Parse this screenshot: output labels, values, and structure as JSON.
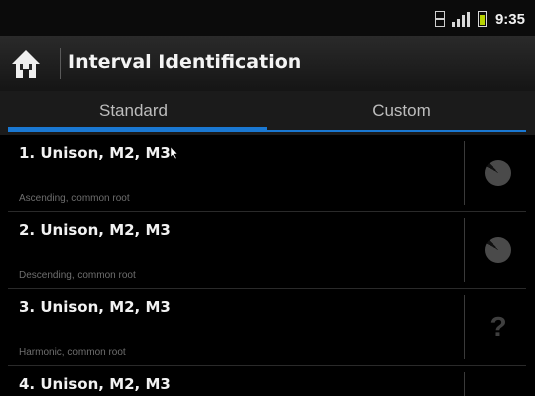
{
  "status_bar": {
    "time": "9:35"
  },
  "action_bar": {
    "title": "Interval Identification"
  },
  "tabs": [
    {
      "label": "Standard",
      "active": true
    },
    {
      "label": "Custom",
      "active": false
    }
  ],
  "list": [
    {
      "title": "1. Unison, M2, M3",
      "subtitle": "Ascending, common root",
      "status_icon": "pie-icon"
    },
    {
      "title": "2. Unison, M2, M3",
      "subtitle": "Descending, common root",
      "status_icon": "pie-icon"
    },
    {
      "title": "3. Unison, M2, M3",
      "subtitle": "Harmonic, common root",
      "status_icon": "question",
      "status_text": "?"
    },
    {
      "title": "4. Unison, M2, M3",
      "subtitle": "",
      "status_icon": "pie-icon"
    }
  ],
  "colors": {
    "accent": "#1a78d2",
    "background": "#000000"
  }
}
